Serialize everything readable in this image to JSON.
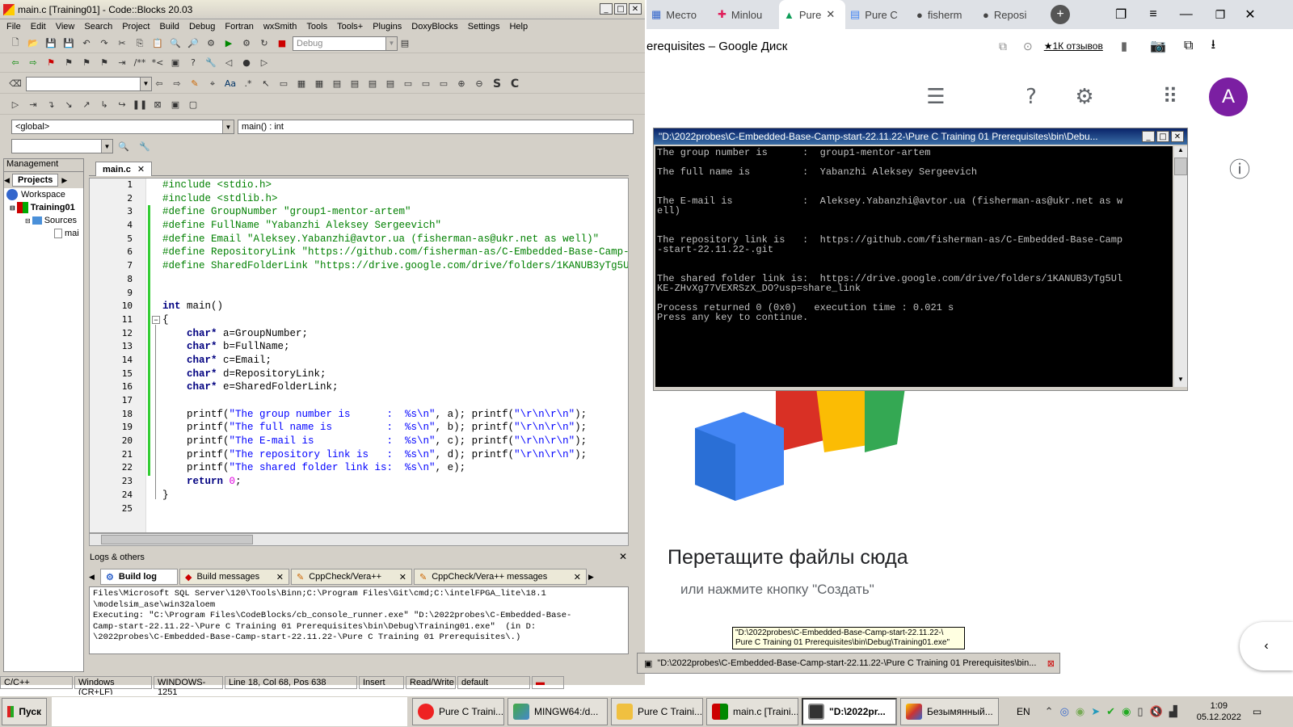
{
  "cb": {
    "title": "main.c [Training01] - Code::Blocks 20.03",
    "menu": [
      "File",
      "Edit",
      "View",
      "Search",
      "Project",
      "Build",
      "Debug",
      "Fortran",
      "wxSmith",
      "Tools",
      "Tools+",
      "Plugins",
      "DoxyBlocks",
      "Settings",
      "Help"
    ],
    "build_target": "Debug",
    "scope": "<global>",
    "function": "main() : int",
    "management_label": "Management",
    "projects_tab": "Projects",
    "tree": [
      "Workspace",
      "Training01",
      "Sources",
      "mai"
    ],
    "file_tab": "main.c",
    "line_numbers": [
      "1",
      "2",
      "3",
      "4",
      "5",
      "6",
      "7",
      "8",
      "9",
      "10",
      "11",
      "12",
      "13",
      "14",
      "15",
      "16",
      "17",
      "18",
      "19",
      "20",
      "21",
      "22",
      "23",
      "24",
      "25"
    ],
    "logs_title": "Logs & others",
    "log_tabs": [
      "Build log",
      "Build messages",
      "CppCheck/Vera++",
      "CppCheck/Vera++ messages"
    ],
    "log_text": "Files\\Microsoft SQL Server\\120\\Tools\\Binn;C:\\Program Files\\Git\\cmd;C:\\intelFPGA_lite\\18.1\n\\modelsim_ase\\win32aloem\nExecuting: \"C:\\Program Files\\CodeBlocks/cb_console_runner.exe\" \"D:\\2022probes\\C-Embedded-Base-\nCamp-start-22.11.22-\\Pure C Training 01 Prerequisites\\bin\\Debug\\Training01.exe\"  (in D:\n\\2022probes\\C-Embedded-Base-Camp-start-22.11.22-\\Pure C Training 01 Prerequisites\\.)",
    "status": [
      "C/C++",
      "Windows (CR+LF)",
      "WINDOWS-1251",
      "Line 18, Col 68, Pos 638",
      "Insert",
      "Read/Write",
      "default"
    ]
  },
  "browser": {
    "tabs": [
      "Место",
      "Minlou",
      "Pure",
      "Pure C",
      "fisherm",
      "Reposi"
    ],
    "page_title": "erequisites – Google Диск",
    "reviews": "★1К отзывов",
    "avatar_letter": "A",
    "drop_title": "Перетащите файлы сюда",
    "drop_sub": "или нажмите кнопку \"Создать\"",
    "tooltip": "\"D:\\2022probes\\C-Embedded-Base-Camp-start-22.11.22-\\\nPure C Training 01 Prerequisites\\bin\\Debug\\Training01.exe\"",
    "minimized": "\"D:\\2022probes\\C-Embedded-Base-Camp-start-22.11.22-\\Pure C Training 01 Prerequisites\\bin..."
  },
  "console": {
    "title": "\"D:\\2022probes\\C-Embedded-Base-Camp-start-22.11.22-\\Pure C Training 01 Prerequisites\\bin\\Debu...",
    "output": "The group number is      :  group1-mentor-artem\n\nThe full name is         :  Yabanzhi Aleksey Sergeevich\n\n\nThe E-mail is            :  Aleksey.Yabanzhi@avtor.ua (fisherman-as@ukr.net as w\nell)\n\n\nThe repository link is   :  https://github.com/fisherman-as/C-Embedded-Base-Camp\n-start-22.11.22-.git\n\n\nThe shared folder link is:  https://drive.google.com/drive/folders/1KANUB3yTg5Ul\nKE-ZHvXg77VEXRSzX_DO?usp=share_link\n\nProcess returned 0 (0x0)   execution time : 0.021 s\nPress any key to continue."
  },
  "taskbar": {
    "start": "Пуск",
    "tasks": [
      "Pure C Traini...",
      "MINGW64:/d...",
      "Pure C Traini...",
      "main.c [Traini...",
      "\"D:\\2022pr...",
      "Безымянный..."
    ],
    "lang": "EN",
    "time": "1:09",
    "date": "05.12.2022"
  }
}
